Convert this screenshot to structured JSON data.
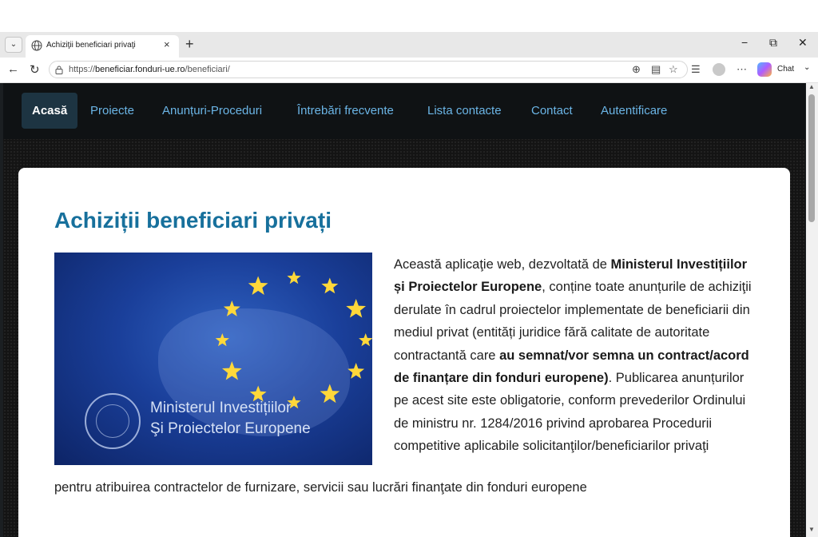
{
  "browser": {
    "tab_title": "Achiziţii beneficiari privaţi",
    "tab_close": "×",
    "new_tab": "+",
    "tab_menu": "⌄",
    "minimize": "−",
    "restore": "⧉",
    "close": "✕",
    "back": "←",
    "reload": "↻",
    "url_prefix": "https://",
    "url_host": "beneficiar.fonduri-ue.ro",
    "url_path": "/beneficiari/",
    "chat_label": "Chat",
    "icons": [
      "zoom-icon",
      "reader-mode-icon",
      "favorite-icon",
      "favorites-icon",
      "profile-icon",
      "more-icon",
      "copilot-icon"
    ]
  },
  "nav": {
    "items": [
      {
        "label": "Acasă",
        "active": true
      },
      {
        "label": "Proiecte"
      },
      {
        "label": "Anunțuri-Proceduri"
      },
      {
        "label": "Întrebări frecvente"
      },
      {
        "label": "Lista contacte"
      },
      {
        "label": "Contact"
      },
      {
        "label": "Autentificare"
      }
    ]
  },
  "page": {
    "heading": "Achiziții beneficiari privați",
    "hero_caption_1": "Ministerul Investițiilor",
    "hero_caption_2": "Şi Proiectelor Europene",
    "p_1": "Această aplicaţie web, dezvoltată de ",
    "p_b1": "Ministerul Investițiilor și Proiectelor Europene",
    "p_2": ", conține toate anunțurile de achiziţii derulate în cadrul proiectelor implementate de beneficiarii din mediul privat (entități juridice fără calitate de autoritate contractantă care ",
    "p_b2": "au semnat/vor semna un contract/acord de finanțare din fonduri europene)",
    "p_3": ". Publicarea anunțurilor pe acest site este obligatorie, conform prevederilor Ordinului de ministru nr. 1284/2016 privind aprobarea Procedurii competitive aplicabile solicitanţilor/beneficiarilor privaţi",
    "p_4": "pentru atribuirea contractelor de furnizare, servicii sau lucrări finanţate din fonduri europene"
  },
  "colors": {
    "nav_link": "#6bb5e6",
    "heading": "#17709c",
    "nav_bg": "#0f1214"
  }
}
